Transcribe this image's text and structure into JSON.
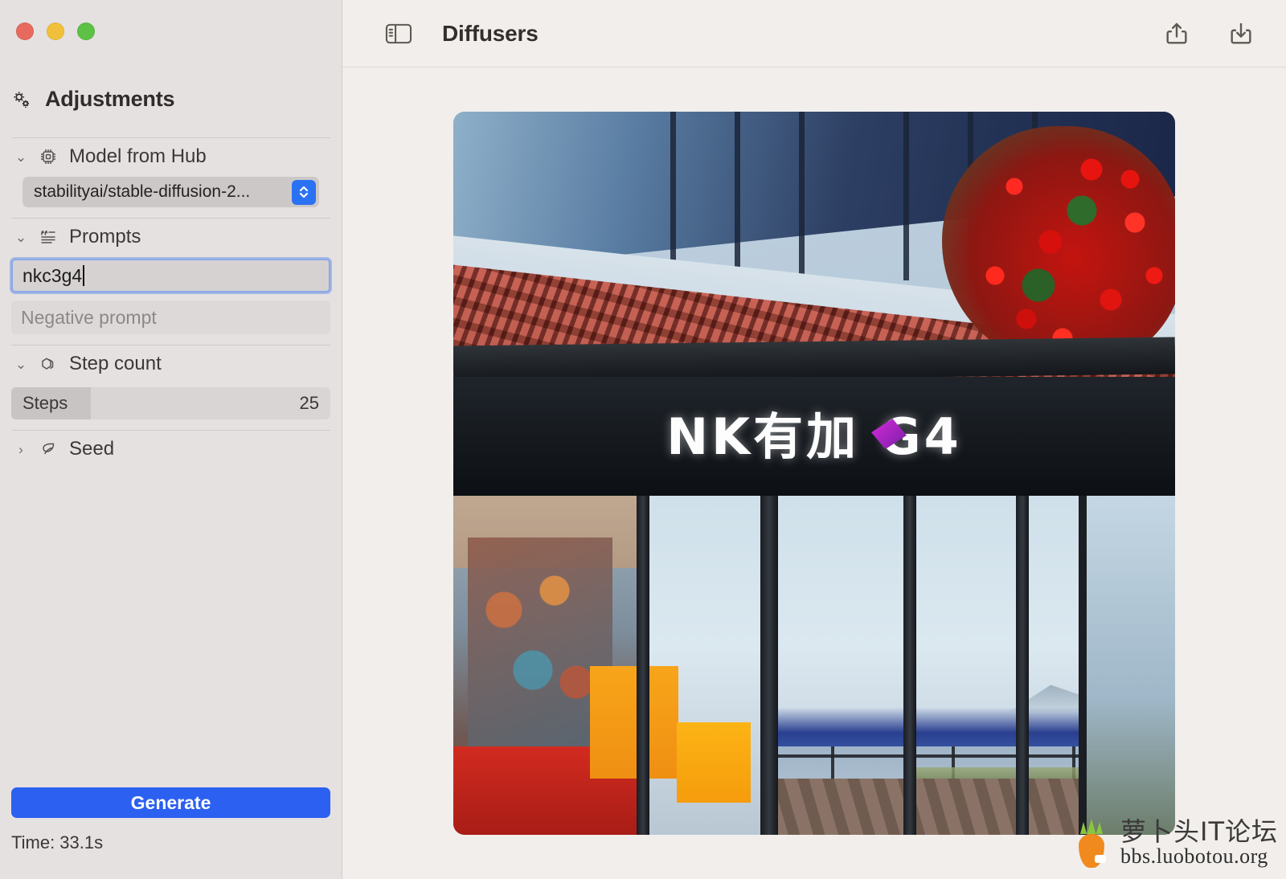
{
  "window": {
    "traffic_lights": [
      {
        "name": "close",
        "color": "#e8695e"
      },
      {
        "name": "minimize",
        "color": "#f0c03c"
      },
      {
        "name": "zoom",
        "color": "#5cc145"
      }
    ]
  },
  "sidebar": {
    "title": "Adjustments",
    "title_icon": "gears-icon",
    "sections": [
      {
        "id": "model",
        "label": "Model from Hub",
        "icon": "chip-icon",
        "expanded": true,
        "chevron": "⌄",
        "selected_value": "stabilityai/stable-diffusion-2...",
        "stepper_color": "#2b71f3"
      },
      {
        "id": "prompts",
        "label": "Prompts",
        "icon": "quote-lines-icon",
        "expanded": true,
        "chevron": "⌄",
        "prompt_value": "nkc3g4",
        "negative_placeholder": "Negative prompt",
        "negative_value": ""
      },
      {
        "id": "step-count",
        "label": "Step count",
        "icon": "cube-icon",
        "expanded": true,
        "chevron": "⌄",
        "slider_label": "Steps",
        "slider_value": "25",
        "slider_fill_percent": 25
      },
      {
        "id": "seed",
        "label": "Seed",
        "icon": "leaf-icon",
        "expanded": false,
        "chevron": "›"
      }
    ],
    "generate_label": "Generate",
    "generate_color": "#2b60f0",
    "time_label": "Time: 33.1s"
  },
  "toolbar": {
    "sidebar_toggle_icon": "sidebar-toggle-icon",
    "title": "Diffusers",
    "share_icon": "share-icon",
    "download_icon": "download-icon"
  },
  "artwork": {
    "sign_text": "NK有加 G4",
    "description": "Generated image: seaside shop with tiled roof, red flowers and dark signboard"
  },
  "watermark": {
    "logo": "carrot-icon",
    "name": "萝卜头IT论坛",
    "url": "bbs.luobotou.org"
  }
}
